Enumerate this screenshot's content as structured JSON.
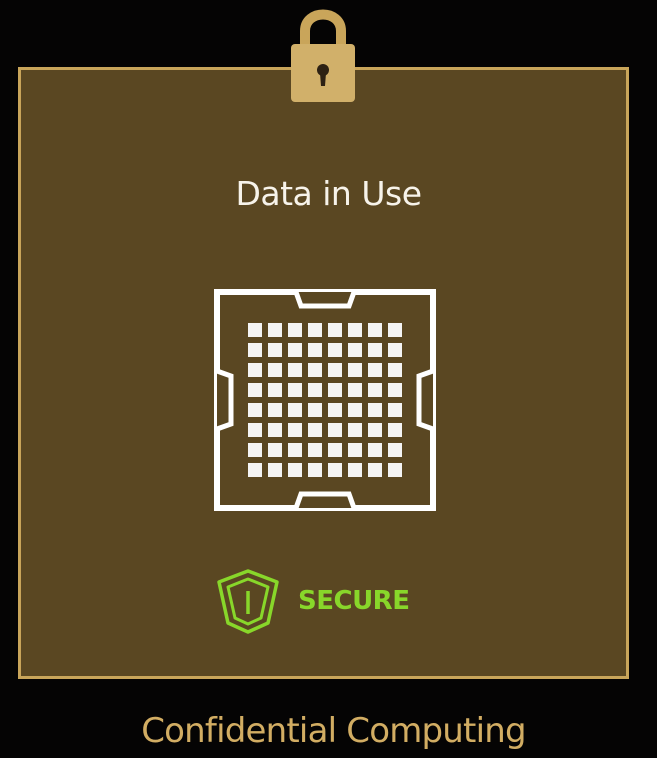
{
  "enclave": {
    "title": "Data in Use"
  },
  "badge": {
    "label": "SECURE",
    "icon": "shield-icon"
  },
  "lock": {
    "icon": "padlock-icon"
  },
  "chip": {
    "icon": "chip-icon"
  },
  "caption": "Confidential Computing",
  "colors": {
    "enclave_fill": "#5a4722",
    "enclave_border": "#c9a55a",
    "title_text": "#f7f3ea",
    "secure_green": "#88d72a",
    "caption_gold": "#d2ad63",
    "background": "#050404"
  }
}
